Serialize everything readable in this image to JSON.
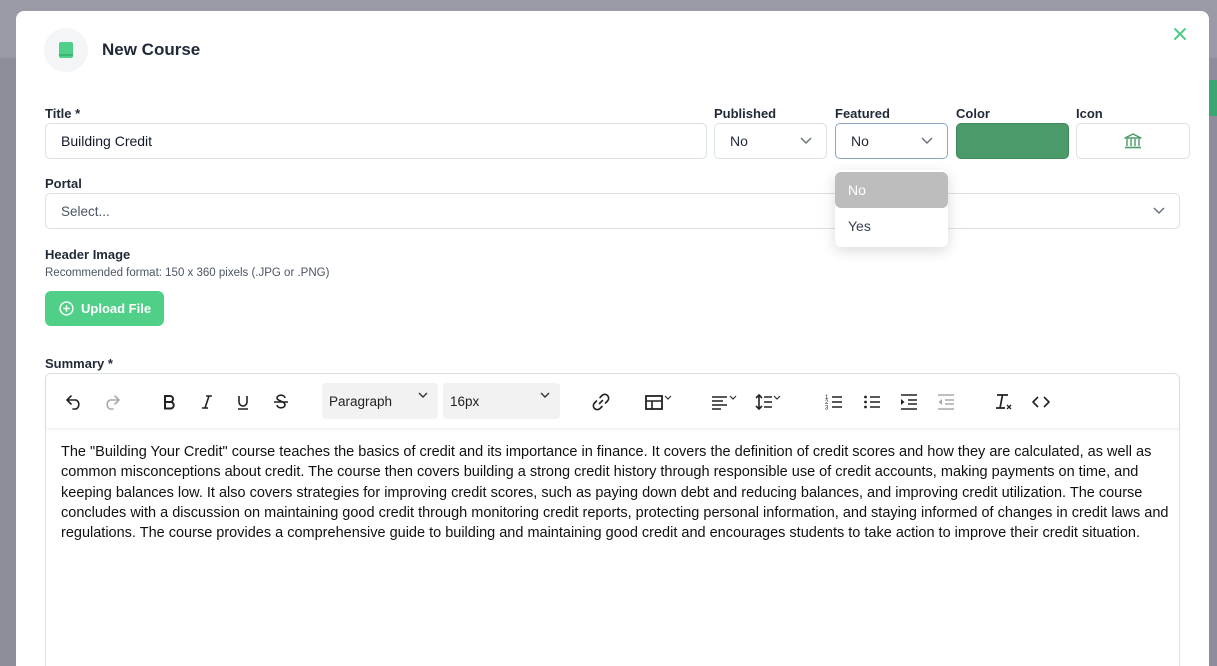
{
  "modal": {
    "title": "New Course",
    "close_icon": "close-icon",
    "header_icon": "book-icon"
  },
  "form": {
    "title_label": "Title *",
    "title_value": "Building Credit",
    "published_label": "Published",
    "published_value": "No",
    "featured_label": "Featured",
    "featured_value": "No",
    "featured_options": [
      "No",
      "Yes"
    ],
    "color_label": "Color",
    "color_value": "#4a9a6a",
    "icon_label": "Icon",
    "icon_value": "institution-icon",
    "portal_label": "Portal",
    "portal_placeholder": "Select...",
    "header_image_label": "Header Image",
    "header_image_hint": "Recommended format: 150 x 360 pixels (.JPG or .PNG)",
    "upload_button": "Upload File",
    "summary_label": "Summary *"
  },
  "editor": {
    "block_format": "Paragraph",
    "font_size": "16px",
    "tools": [
      "undo-icon",
      "redo-icon",
      "bold-icon",
      "italic-icon",
      "underline-icon",
      "strikethrough-icon",
      "link-icon",
      "table-icon",
      "align-icon",
      "line-height-icon",
      "ordered-list-icon",
      "bullet-list-icon",
      "indent-icon",
      "outdent-icon",
      "clear-format-icon",
      "code-icon"
    ],
    "content": "The \"Building Your Credit\" course teaches the basics of credit and its importance in finance. It covers the definition of credit scores and how they are calculated, as well as common misconceptions about credit. The course then covers building a strong credit history through responsible use of credit accounts, making payments on time, and keeping balances low. It also covers strategies for improving credit scores, such as paying down debt and reducing balances, and improving credit utilization. The course concludes with a discussion on maintaining good credit through monitoring credit reports, protecting personal information, and staying informed of changes in credit laws and regulations. The course provides a comprehensive guide to building and maintaining good credit and encourages students to take action to improve their credit situation."
  },
  "colors": {
    "accent": "#4fcf87",
    "chosen_color": "#4a9a6a",
    "focus_border": "#8ba7c7"
  }
}
